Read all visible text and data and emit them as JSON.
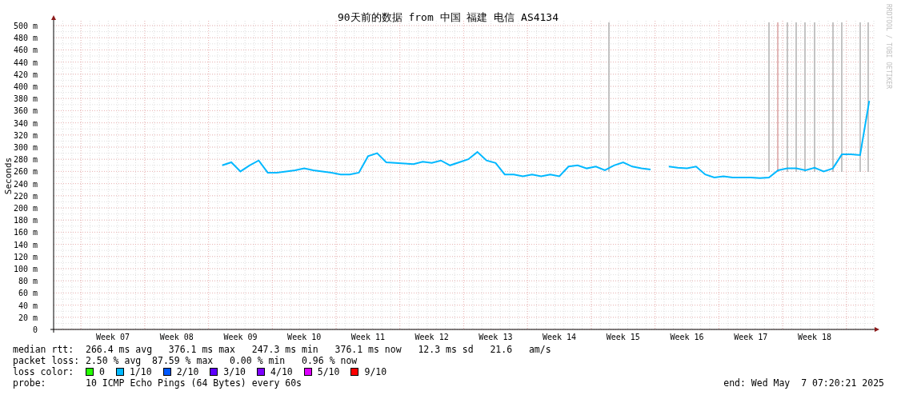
{
  "chart": {
    "chart_data": {
      "type": "line",
      "title": "90天前的数据 from 中国 福建 电信 AS4134",
      "ylabel": "Seconds",
      "grid": true,
      "ylim": [
        0,
        500
      ],
      "categories": [
        null,
        null,
        null,
        null,
        null,
        null,
        "Week 07",
        null,
        null,
        null,
        null,
        null,
        null,
        "Week 08",
        null,
        null,
        null,
        null,
        null,
        null,
        "Week 09",
        null,
        null,
        null,
        null,
        null,
        null,
        "Week 10",
        null,
        null,
        null,
        null,
        null,
        null,
        "Week 11",
        null,
        null,
        null,
        null,
        null,
        null,
        "Week 12",
        null,
        null,
        null,
        null,
        null,
        null,
        "Week 13",
        null,
        null,
        null,
        null,
        null,
        null,
        "Week 14",
        null,
        null,
        null,
        null,
        null,
        null,
        "Week 15",
        null,
        null,
        null,
        null,
        null,
        null,
        "Week 16",
        null,
        null,
        null,
        null,
        null,
        null,
        "Week 17",
        null,
        null,
        null,
        null,
        null,
        null,
        "Week 18",
        null,
        null,
        null,
        null,
        null,
        null
      ],
      "series": [
        {
          "color": "#00b8ff",
          "values": [
            null,
            null,
            null,
            null,
            null,
            null,
            null,
            null,
            null,
            null,
            null,
            null,
            null,
            null,
            null,
            null,
            null,
            null,
            270,
            275,
            260,
            270,
            278,
            258,
            258,
            260,
            262,
            265,
            262,
            260,
            258,
            255,
            255,
            258,
            285,
            290,
            275,
            274,
            273,
            272,
            276,
            274,
            278,
            270,
            275,
            280,
            292,
            278,
            274,
            255,
            255,
            252,
            255,
            252,
            255,
            252,
            268,
            270,
            265,
            268,
            262,
            270,
            275,
            268,
            265,
            263,
            null,
            268,
            266,
            265,
            268,
            255,
            250,
            252,
            250,
            250,
            250,
            249,
            250,
            262,
            265,
            265,
            262,
            266,
            260,
            265,
            288,
            288,
            287,
            376
          ]
        }
      ],
      "yticks": [
        {
          "value": 0,
          "label": "0"
        },
        {
          "value": 20,
          "label": "20 m"
        },
        {
          "value": 40,
          "label": "40 m"
        },
        {
          "value": 60,
          "label": "60 m"
        },
        {
          "value": 80,
          "label": "80 m"
        },
        {
          "value": 100,
          "label": "100 m"
        },
        {
          "value": 120,
          "label": "120 m"
        },
        {
          "value": 140,
          "label": "140 m"
        },
        {
          "value": 160,
          "label": "160 m"
        },
        {
          "value": 180,
          "label": "180 m"
        },
        {
          "value": 200,
          "label": "200 m"
        },
        {
          "value": 220,
          "label": "220 m"
        },
        {
          "value": 240,
          "label": "240 m"
        },
        {
          "value": 260,
          "label": "260 m"
        },
        {
          "value": 280,
          "label": "280 m"
        },
        {
          "value": 300,
          "label": "300 m"
        },
        {
          "value": 320,
          "label": "320 m"
        },
        {
          "value": 340,
          "label": "340 m"
        },
        {
          "value": 360,
          "label": "360 m"
        },
        {
          "value": 380,
          "label": "380 m"
        },
        {
          "value": 400,
          "label": "400 m"
        },
        {
          "value": 420,
          "label": "420 m"
        },
        {
          "value": 440,
          "label": "440 m"
        },
        {
          "value": 460,
          "label": "460 m"
        },
        {
          "value": 480,
          "label": "480 m"
        },
        {
          "value": 500,
          "label": "500 m"
        }
      ]
    },
    "credit": "RRDTOOL / TOBI OETIKER"
  },
  "legend": {
    "stats": [
      {
        "label": "median rtt:",
        "value": "266.4 ms avg   376.1 ms max   247.3 ms min   376.1 ms now   12.3 ms sd   21.6   am/s"
      },
      {
        "label": "packet loss:",
        "value": "2.50 % avg  87.59 % max   0.00 % min   0.96 % now"
      }
    ],
    "loss_color_label": "loss color:",
    "loss_colors": [
      {
        "label": "0",
        "color": "#26ff00"
      },
      {
        "label": "1/10",
        "color": "#00b8ff"
      },
      {
        "label": "2/10",
        "color": "#0059ff"
      },
      {
        "label": "3/10",
        "color": "#5e00ff"
      },
      {
        "label": "4/10",
        "color": "#7e00ff"
      },
      {
        "label": "5/10",
        "color": "#dd00ff"
      },
      {
        "label": "9/10",
        "color": "#ff0000"
      }
    ],
    "probe": {
      "label": "probe:",
      "value": "10 ICMP Echo Pings (64 Bytes) every 60s"
    },
    "end": "end: Wed May  7 07:20:21 2025"
  }
}
